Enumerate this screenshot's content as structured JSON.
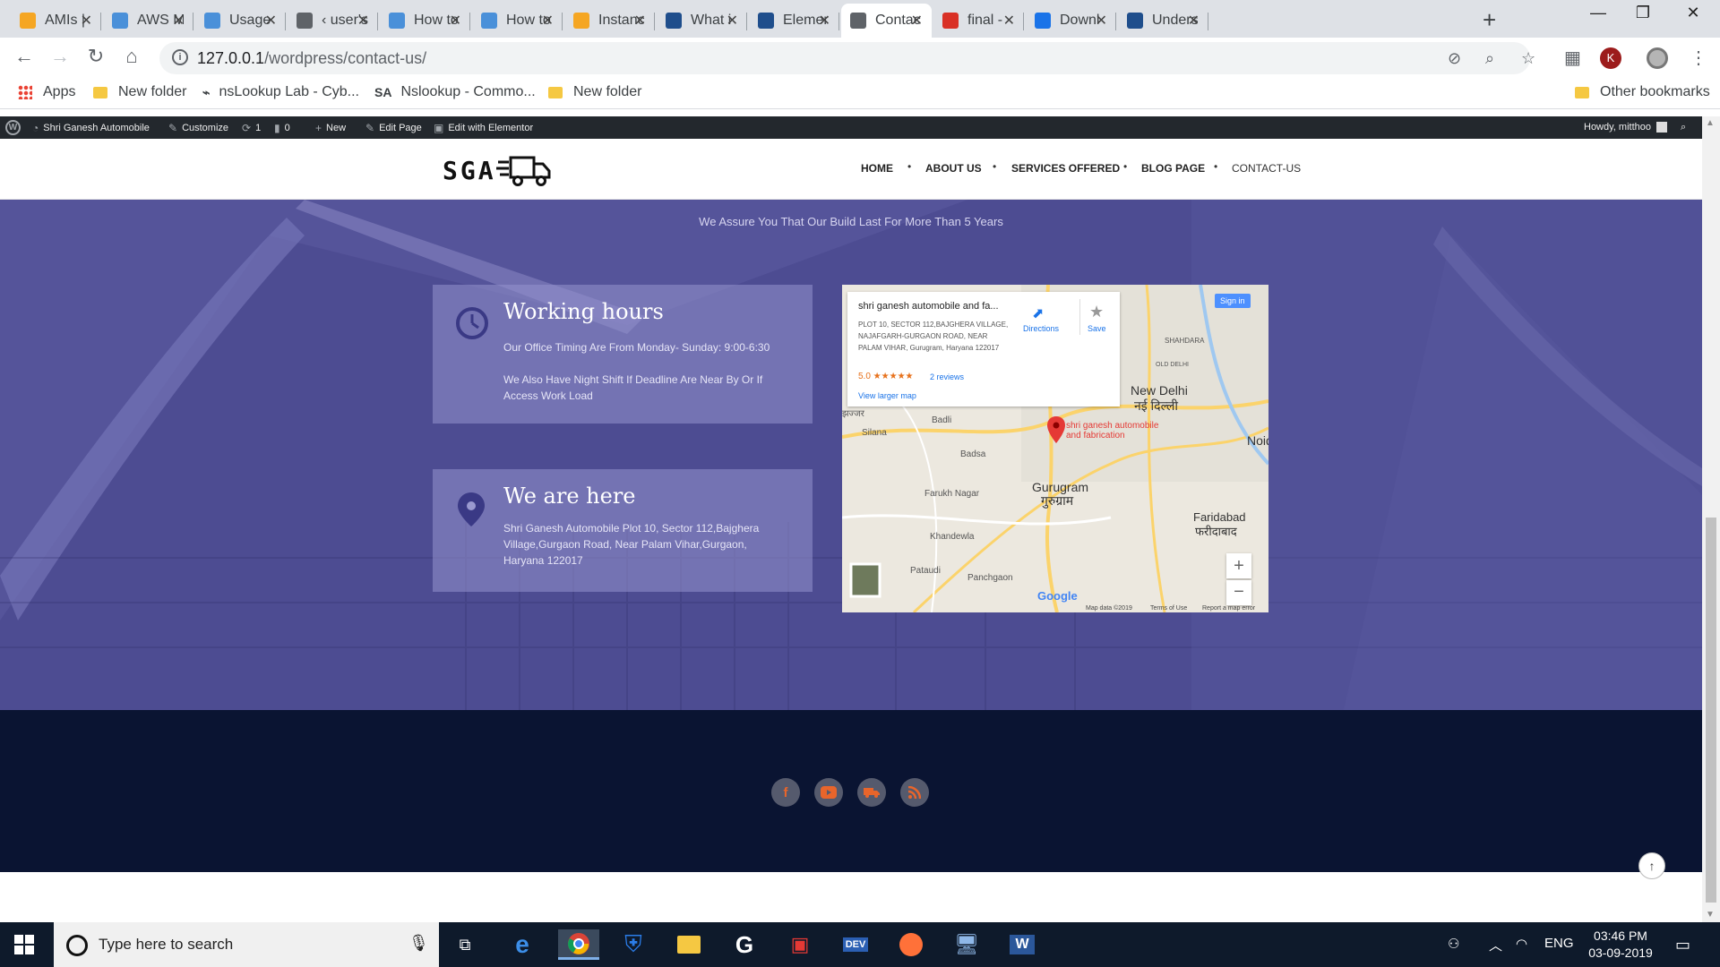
{
  "browser": {
    "tabs": [
      {
        "label": "AMIs |",
        "color": "#f5a623"
      },
      {
        "label": "AWS M",
        "color": "#4a90d9"
      },
      {
        "label": "Usage",
        "color": "#4a90d9"
      },
      {
        "label": "‹ user's",
        "color": "#5f6368"
      },
      {
        "label": "How to",
        "color": "#4a90d9"
      },
      {
        "label": "How to",
        "color": "#4a90d9"
      },
      {
        "label": "Instanc",
        "color": "#f5a623"
      },
      {
        "label": "What i",
        "color": "#1f4e8c"
      },
      {
        "label": "Elemer",
        "color": "#1f4e8c"
      },
      {
        "label": "Contac",
        "color": "#5f6368",
        "active": true
      },
      {
        "label": "final - ",
        "color": "#d93025"
      },
      {
        "label": "Downl",
        "color": "#1a73e8"
      },
      {
        "label": "Unders",
        "color": "#1f4e8c"
      }
    ],
    "url_host": "127.0.0.1",
    "url_path": "/wordpress/contact-us/",
    "profile_initial": "K"
  },
  "bookmarks": {
    "items": [
      "Apps",
      "New folder",
      "nsLookup Lab - Cyb...",
      "Nslookup - Commo...",
      "New folder"
    ],
    "other": "Other bookmarks"
  },
  "wpbar": {
    "site": "Shri Ganesh Automobile",
    "customize": "Customize",
    "updates": "1",
    "comments": "0",
    "new": "New",
    "edit_page": "Edit Page",
    "elementor": "Edit with Elementor",
    "howdy": "Howdy, mitthoo"
  },
  "site": {
    "logo_text": "SGA",
    "nav": [
      "HOME",
      "ABOUT US",
      "SERVICES OFFERED",
      "BLOG PAGE",
      "CONTACT-US"
    ]
  },
  "hero": {
    "tagline": "We Assure You That Our Build Last For More Than 5 Years",
    "hours_title": "Working hours",
    "hours_line1": "Our Office Timing Are From Monday- Sunday: 9:00-6:30",
    "hours_line2": "We Also Have Night Shift If Deadline Are Near By Or If Access Work Load",
    "location_title": "We are here",
    "location_text": "Shri Ganesh Automobile Plot 10, Sector 112,Bajghera Village,Gurgaon Road, Near Palam Vihar,Gurgaon, Haryana 122017"
  },
  "map": {
    "place_title": "shri ganesh automobile and fa...",
    "address": "PLOT 10, SECTOR 112,BAJGHERA VILLAGE, NAJAFGARH-GURGAON ROAD, NEAR PALAM VIHAR, Gurugram, Haryana 122017",
    "rating": "5.0 ★★★★★",
    "reviews": "2 reviews",
    "larger_map": "View larger map",
    "directions": "Directions",
    "save": "Save",
    "sign_in": "Sign in",
    "marker_label": "shri ganesh automobile and fabrication",
    "labels": {
      "new_delhi": "New Delhi",
      "new_delhi_hi": "नई दिल्ली",
      "gurugram": "Gurugram",
      "gurugram_hi": "गुरुग्राम",
      "faridabad": "Faridabad",
      "faridabad_hi": "फरीदाबाद",
      "noida": "Noid",
      "shahdara": "SHAHDARA",
      "old_delhi": "OLD DELHI",
      "badli": "Badli",
      "silana": "Silana",
      "badsa": "Badsa",
      "farukh_nagar": "Farukh Nagar",
      "khandewla": "Khandewla",
      "pataudi": "Pataudi",
      "panchgaon": "Panchgaon",
      "jhajjar": "झज्जर"
    },
    "google": "Google",
    "map_data": "Map data ©2019",
    "terms": "Terms of Use",
    "report": "Report a map error"
  },
  "footer": {
    "social": [
      "facebook-icon",
      "youtube-icon",
      "truck-icon",
      "rss-icon"
    ]
  },
  "taskbar": {
    "search_placeholder": "Type here to search",
    "lang": "ENG",
    "time": "03:46 PM",
    "date": "03-09-2019"
  },
  "colors": {
    "hero_purple": "#55549a",
    "footer_navy": "#0a1432",
    "wp_bar": "#23282d"
  }
}
